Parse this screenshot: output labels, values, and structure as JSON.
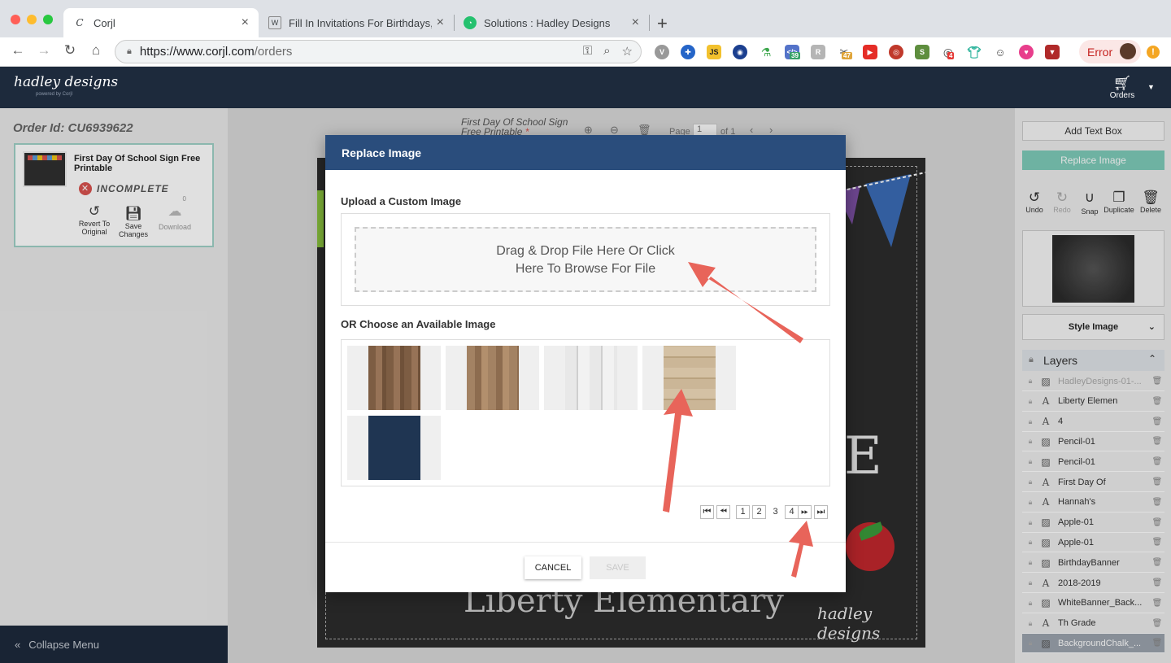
{
  "browser": {
    "tabs": [
      {
        "title": "Corjl",
        "active": true,
        "icon": "corjl-icon"
      },
      {
        "title": "Fill In Invitations For Birthdays,",
        "active": false,
        "icon": "page-icon"
      },
      {
        "title": "Solutions : Hadley Designs",
        "active": false,
        "icon": "freshdesk-icon"
      }
    ],
    "url_host": "https://www.corjl.com",
    "url_path": "/orders",
    "extension_badges": [
      "39",
      "47",
      "4"
    ],
    "error_label": "Error"
  },
  "header": {
    "logo": "hadley designs",
    "logo_sub": "powered by Corjl",
    "orders_label": "Orders"
  },
  "left": {
    "order_id": "Order Id: CU6939622",
    "card_title": "First Day Of School Sign Free Printable",
    "status": "INCOMPLETE",
    "actions": {
      "revert": "Revert To Original",
      "save": "Save Changes",
      "download": "Download",
      "download_count": "0"
    },
    "collapse": "Collapse Menu"
  },
  "canvas": {
    "title": "First Day Of School Sign Free Printable",
    "required_mark": "*",
    "page_label": "Page",
    "page_value": "1",
    "page_of": "of 1",
    "design_text_e": "E",
    "design_text_liberty": "Liberty Elementary",
    "design_signature": "hadley designs"
  },
  "modal": {
    "title": "Replace Image",
    "upload_label": "Upload a Custom Image",
    "dropzone_line1": "Drag & Drop File Here Or Click",
    "dropzone_line2": "Here To Browse For File",
    "choose_label": "OR Choose an Available Image",
    "gallery_colors": [
      "#8b6a4e",
      "#9a7a5c",
      "#dcdcdc",
      "#c9b596",
      "#1f3552"
    ],
    "pages": [
      "1",
      "2",
      "3",
      "4"
    ],
    "current_page": "3",
    "cancel": "CANCEL",
    "save": "SAVE"
  },
  "right": {
    "add_text_box": "Add Text Box",
    "replace_image": "Replace Image",
    "tools": {
      "undo": "Undo",
      "redo": "Redo",
      "snap": "Snap",
      "duplicate": "Duplicate",
      "delete": "Delete"
    },
    "style_image": "Style Image",
    "layers_title": "Layers",
    "layers": [
      {
        "name": "HadleyDesigns-01-...",
        "type": "image"
      },
      {
        "name": "Liberty Elemen",
        "type": "text"
      },
      {
        "name": "4",
        "type": "text"
      },
      {
        "name": "Pencil-01",
        "type": "image"
      },
      {
        "name": "Pencil-01",
        "type": "image"
      },
      {
        "name": "First Day Of",
        "type": "text"
      },
      {
        "name": "Hannah's",
        "type": "text"
      },
      {
        "name": "Apple-01",
        "type": "image"
      },
      {
        "name": "Apple-01",
        "type": "image"
      },
      {
        "name": "BirthdayBanner",
        "type": "image"
      },
      {
        "name": "2018-2019",
        "type": "text"
      },
      {
        "name": "WhiteBanner_Back...",
        "type": "image"
      },
      {
        "name": "Th Grade",
        "type": "text"
      },
      {
        "name": "BackgroundChalk_...",
        "type": "image"
      }
    ]
  },
  "colors": {
    "modal_header": "#2a4d7c",
    "app_header": "#1d2a3c",
    "accent_teal": "#7ecbb9",
    "annotation_arrow": "#e8645a"
  }
}
